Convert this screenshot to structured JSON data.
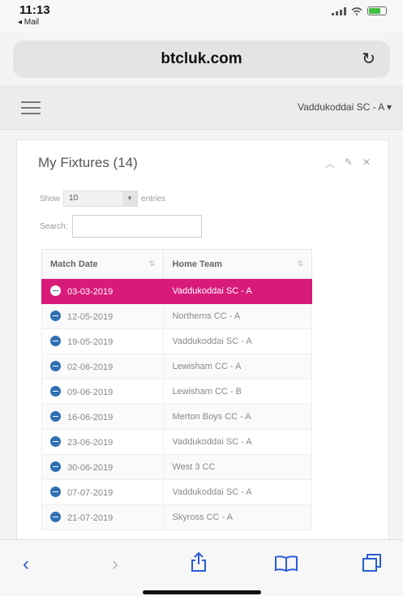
{
  "status": {
    "time": "11:13",
    "back_label": "◂ Mail"
  },
  "browser": {
    "url": "btcluk.com"
  },
  "header": {
    "team_selected": "Vaddukoddai SC - A"
  },
  "panel": {
    "title": "My Fixtures (14)",
    "show_label": "Show",
    "entries_value": "10",
    "entries_label": "entries",
    "search_label": "Search:",
    "search_value": ""
  },
  "table": {
    "columns": [
      "Match Date",
      "Home Team"
    ],
    "rows": [
      {
        "date": "03-03-2019",
        "home": "Vaddukoddai SC - A",
        "selected": true
      },
      {
        "date": "12-05-2019",
        "home": "Northerns CC - A"
      },
      {
        "date": "19-05-2019",
        "home": "Vaddukoddai SC - A"
      },
      {
        "date": "02-06-2019",
        "home": "Lewisham CC - A"
      },
      {
        "date": "09-06-2019",
        "home": "Lewisham CC - B"
      },
      {
        "date": "16-06-2019",
        "home": "Merton Boys CC - A"
      },
      {
        "date": "23-06-2019",
        "home": "Vaddukoddai SC - A"
      },
      {
        "date": "30-06-2019",
        "home": "West 3 CC"
      },
      {
        "date": "07-07-2019",
        "home": "Vaddukoddai SC - A"
      },
      {
        "date": "21-07-2019",
        "home": "Skyross CC - A"
      }
    ]
  },
  "colors": {
    "accent": "#d81b7a",
    "ios_blue": "#2a5bd7",
    "dot": "#2f6fb3"
  },
  "icons": [
    "reload-icon",
    "hamburger-icon",
    "back-icon",
    "forward-icon",
    "share-icon",
    "bookmarks-icon",
    "tabs-icon"
  ]
}
